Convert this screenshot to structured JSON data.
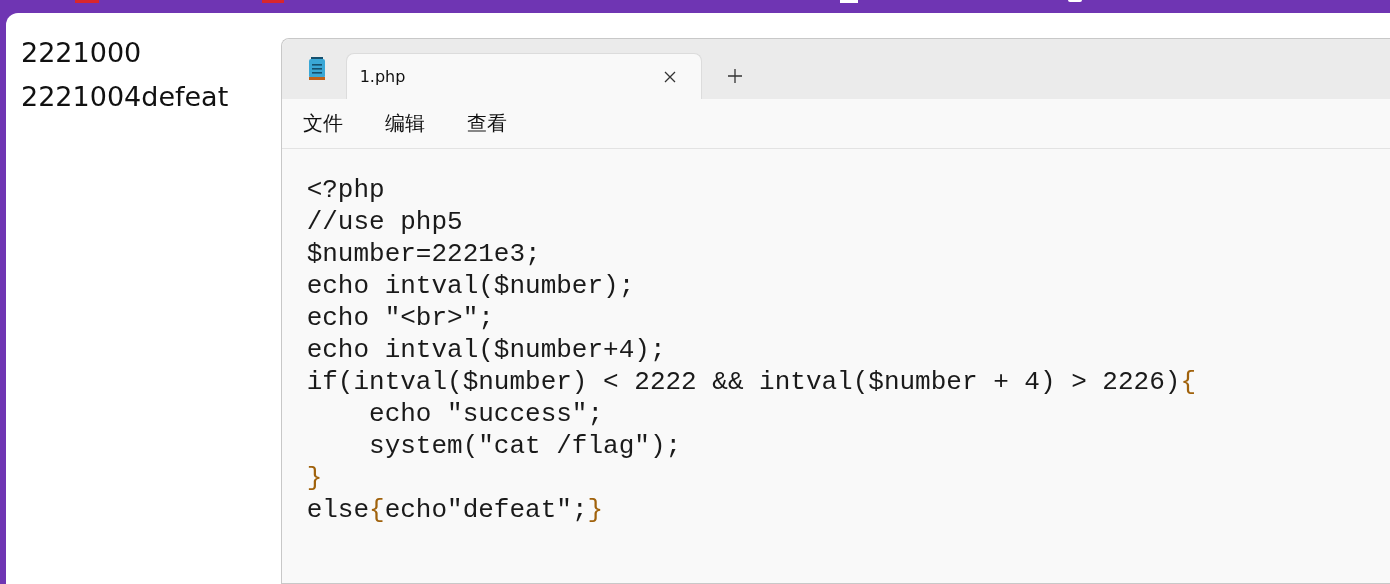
{
  "browser_output": [
    "2221000",
    "2221004defeat"
  ],
  "notepad": {
    "tabs": [
      {
        "label": "1.php",
        "selected": true
      }
    ],
    "menu": [
      "文件",
      "编辑",
      "查看"
    ],
    "code_lines": [
      [
        {
          "kind": "plain",
          "text": "<?php"
        }
      ],
      [
        {
          "kind": "plain",
          "text": "//use php5"
        }
      ],
      [
        {
          "kind": "plain",
          "text": "$number=2221e3;"
        }
      ],
      [
        {
          "kind": "plain",
          "text": "echo intval($number);"
        }
      ],
      [
        {
          "kind": "plain",
          "text": "echo \"<br>\";"
        }
      ],
      [
        {
          "kind": "plain",
          "text": "echo intval($number+4);"
        }
      ],
      [
        {
          "kind": "plain",
          "text": "if(intval($number) < 2222 && intval($number + 4) > 2226)"
        },
        {
          "kind": "brace",
          "text": "{"
        }
      ],
      [
        {
          "kind": "plain",
          "text": "    echo \"success\";"
        }
      ],
      [
        {
          "kind": "plain",
          "text": "    system(\"cat /flag\");"
        }
      ],
      [
        {
          "kind": "brace",
          "text": "}"
        }
      ],
      [
        {
          "kind": "plain",
          "text": "else"
        },
        {
          "kind": "brace",
          "text": "{"
        },
        {
          "kind": "plain",
          "text": "echo\"defeat\";"
        },
        {
          "kind": "brace",
          "text": "}"
        }
      ]
    ]
  }
}
